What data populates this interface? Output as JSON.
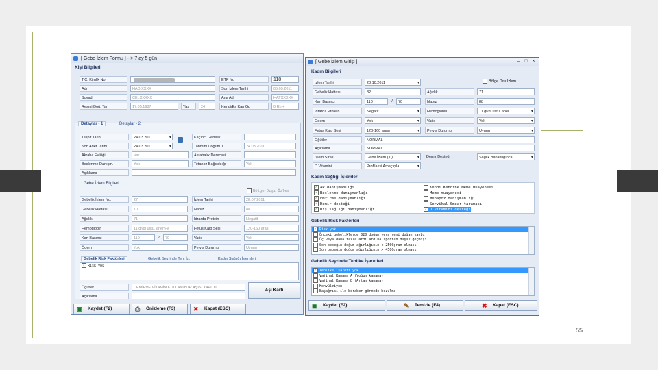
{
  "page_number": "55",
  "left": {
    "title": "[ Gebe İzlem Formu ]  -->  7 ay 5 gün",
    "kisi_title": "Kişi Bilgileri",
    "tc_label": "T.C. Kimlik No",
    "ad_label": "Adı",
    "ad_value": "HADİXXXX",
    "soyadi_label": "Soyadı",
    "soyadi_value": "CELXXXXX",
    "dogum_label": "Resmi Doğ. Tar.",
    "dogum_value": "17.05.1987",
    "yas_label": "Yaş",
    "yas_value": "24",
    "etf_label": "ETF No",
    "etf_value": "118",
    "son_izlem_label": "Son İzlem Tarihi",
    "son_izlem_value": "05.09.2011",
    "ana_adi_label": "Ana Adı",
    "ana_adi_value": "HATXXXXX",
    "kan_grubu_label": "Kendi/Eş Kan Gr.",
    "kan_grubu_value": "0 Rh +",
    "tab1": "Detaylar - 1",
    "tab2": "Detaylar - 2",
    "tespit_label": "Tespit Tarihi",
    "tespit_value": "24.03.2011",
    "son_adet_label": "Son Adet Tarihi",
    "son_adet_value": "24.03.2011",
    "akraba_label": "Akraba Evliliği",
    "akraba_value": "Var",
    "beslenme_label": "Beslenme Danışm.",
    "beslenme_value": "Yok",
    "aciklama_label": "Açıklama",
    "kacinci_label": "Kaçıncı Gebelik",
    "kacinci_value": "1",
    "tahmini_label": "Tahmini Doğum T.",
    "tahmini_value": "24.03.2011",
    "akrabalik_label": "Akrabalık Derecesi",
    "tetanoz_label": "Tetanoz Bağışıklığı",
    "tetanoz_value": "Yok",
    "gebe_izlem_title": "Gebe İzlem Bilgileri",
    "bolge_disi": "Bölge Dışı İzlem",
    "gebelik_izlem_label": "Gebelik İzlem No.",
    "gebelik_izlem_value": "27",
    "gebelik_haftasi_label": "Gebelik Haftası",
    "gebelik_haftasi_value": "10",
    "agirlik_label": "Ağırlık",
    "agirlik_value": "71",
    "hemoglobin_label": "Hemoglobin",
    "hemoglobin_value": "11 gr/dl üstü, anem-y",
    "kan_basinci_label": "Kan Basıncı",
    "kb1": "110",
    "kb_sep": "/",
    "kb2": "70",
    "odem_label": "Ödem",
    "odem_value": "Yok",
    "izlem_tarihi_label": "İzlem Tarihi",
    "izlem_tarihi_value": "28.07.2011",
    "nabiz_label": "Nabız",
    "nabiz_value": "88",
    "idrarda_label": "İdrarda Protein",
    "idrarda_value": "Negatif",
    "fetus_label": "Fetus Kalp Sesi",
    "fetus_value": "120-160 arası",
    "varis_label": "Varis",
    "varis_value": "Yok",
    "pelvis_label": "Pelvis Durumu",
    "pelvis_value": "Uygun",
    "subtab1": "Gebelik Risk Faktörleri",
    "subtab2": "Gebelik Seyrinde Teh. İş.",
    "subtab3": "Kadın Sağlığı İşlemleri",
    "risk_item": "Risk yok",
    "oguler_label": "Öğütler",
    "oguler_value": "DEMİRVE VİTAMİN KULLANIYOR AŞISI YAPILDI",
    "aciklama2_label": "Açıklama",
    "asi_karti": "Aşı Kartı",
    "kaydet": "Kaydet (F2)",
    "onizleme": "Önizleme (F3)",
    "kapat": "Kapat (ESC)"
  },
  "right": {
    "title": "[ Gebe İzlem Girişi ]",
    "kadin_title": "Kadın Bilgileri",
    "bolge_disi": "Bölge Dışı İzlem",
    "izlem_tarihi_label": "İzlem Tarihi",
    "izlem_tarihi_value": "28.10.2011",
    "gebelik_haftasi_label": "Gebelik Haftası",
    "gebelik_haftasi_value": "32",
    "kan_basinci_label": "Kan Basıncı",
    "kb1": "110",
    "kb_sep": "/",
    "kb2": "70",
    "idrarda_label": "İdrarda Protein",
    "idrarda_value": "Negatif",
    "odem_label": "Ödem",
    "odem_value": "Yok",
    "fetus_label": "Fetus Kalp Sesi",
    "fetus_value": "120-160 arası",
    "oguler_label": "Öğütler",
    "oguler_value": "NORMAL",
    "aciklama_label": "Açıklama",
    "aciklama_value": "NORMAL",
    "izlem_sirasi_label": "İzlem Sırası",
    "izlem_sirasi_value": "Gebe İzlem (III)",
    "d_vitamini_label": "D Vitamini",
    "d_vitamini_value": "Profilaksi Amaçlıyla",
    "agirlik_label": "Ağırlık",
    "agirlik_value": "71",
    "nabiz_label": "Nabız",
    "nabiz_value": "88",
    "hemoglobin_label": "Hemoglobin",
    "hemoglobin_value": "11 gr/dl üstü, aner",
    "varis_label": "Varis",
    "varis_value": "Yok",
    "pelvis_label": "Pelvis Durumu",
    "pelvis_value": "Uygun",
    "destek_label": "Demir Desteği",
    "destek_value": "Sağlık Bakanlığınca",
    "kadin_saglik_title": "Kadın Sağlığı İşlemleri",
    "ks_left": [
      {
        "text": "AP danışmanlığı",
        "checked": "✓"
      },
      {
        "text": "Beslenme danışmanlığı",
        "checked": "✓"
      },
      {
        "text": "Emzirme danışmanlığı",
        "checked": "✓"
      },
      {
        "text": "Demir desteği",
        "checked": "✓"
      },
      {
        "text": "Diş sağlığı danışmanlığı",
        "checked": "✓"
      }
    ],
    "ks_right": [
      {
        "text": "Kendi Kendine Meme Muayenesi",
        "checked": ""
      },
      {
        "text": "Meme muayenesi",
        "checked": ""
      },
      {
        "text": "Menapoz danışmanlığı",
        "checked": ""
      },
      {
        "text": "Servikal Smear taraması",
        "checked": ""
      },
      {
        "text": "D Vitamini desteği",
        "checked": "✓"
      }
    ],
    "risk_title": "Gebelik Risk Faktörleri",
    "risk_items": [
      {
        "text": "Risk yok",
        "checked": "✓"
      },
      {
        "text": "Önceki gebeliklerde 020 doğum veya yeni doğan kaybı",
        "checked": ""
      },
      {
        "text": "Üç veya daha fazla ardı ardına spontan düşük geçmişi",
        "checked": ""
      },
      {
        "text": "Son bebeğin doğum ağırlığının < 2500gram olması",
        "checked": ""
      },
      {
        "text": "Son bebeğin doğum ağırlığının > 4500gram olması",
        "checked": ""
      }
    ],
    "tehlike_title": "Gebelik Seyrinde Tehlike İşaretleri",
    "tehlike_items": [
      {
        "text": "Tehlike işareti yok",
        "checked": "✓"
      },
      {
        "text": "Vajinal Kanama A (Yoğun kanama)",
        "checked": ""
      },
      {
        "text": "Vajinal Kanama B (Artan kanama)",
        "checked": ""
      },
      {
        "text": "Konvülziyon",
        "checked": ""
      },
      {
        "text": "Başağrısı ile beraber görmede bozulma",
        "checked": ""
      }
    ],
    "kaydet": "Kaydet (F2)",
    "temizle": "Temizle (F4)",
    "kapat": "Kapat (ESC)"
  }
}
